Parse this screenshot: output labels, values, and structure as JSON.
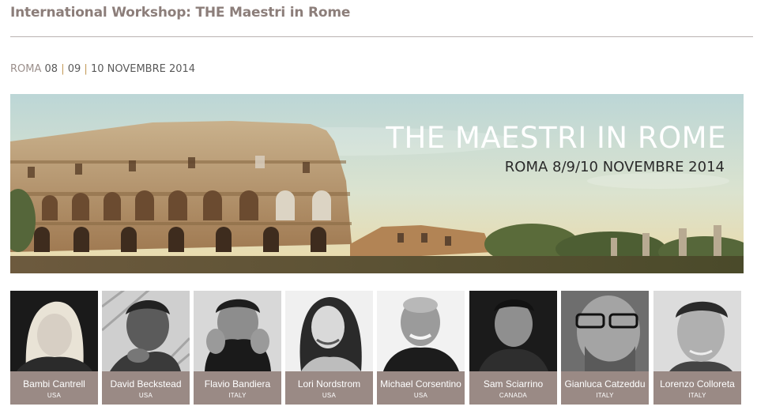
{
  "page": {
    "title": "International Workshop: THE Maestri in Rome",
    "dateline": {
      "city": "ROMA",
      "day1": "08",
      "sep1": "|",
      "day2": "09",
      "sep2": "|",
      "rest": "10 NOVEMBRE 2014"
    }
  },
  "banner": {
    "title": "THE MAESTRI IN ROME",
    "subtitle": "ROMA 8/9/10 NOVEMBRE 2014"
  },
  "speakers": [
    {
      "name": "Bambi Cantrell",
      "country": "USA"
    },
    {
      "name": "David Beckstead",
      "country": "USA"
    },
    {
      "name": "Flavio Bandiera",
      "country": "ITALY"
    },
    {
      "name": "Lori Nordstrom",
      "country": "USA"
    },
    {
      "name": "Michael Corsentino",
      "country": "USA"
    },
    {
      "name": "Sam Sciarrino",
      "country": "CANADA"
    },
    {
      "name": "Gianluca Catzeddu",
      "country": "ITALY"
    },
    {
      "name": "Lorenzo Colloreta",
      "country": "ITALY"
    }
  ],
  "colors": {
    "title": "#8c7e7a",
    "caption_bg": "#9a8a85",
    "rule": "#b9b3b1"
  }
}
